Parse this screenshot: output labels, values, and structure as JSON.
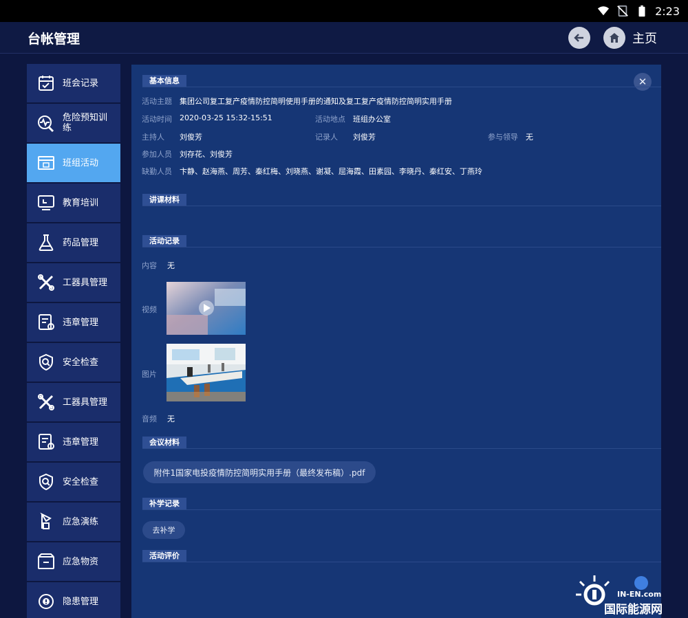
{
  "status_bar": {
    "time": "2:23"
  },
  "header": {
    "title": "台帐管理",
    "home_label": "主页"
  },
  "sidebar": {
    "items": [
      {
        "label": "班会记录",
        "icon": "calendar-icon"
      },
      {
        "label": "危险预知训练",
        "icon": "pulse-icon"
      },
      {
        "label": "班组活动",
        "icon": "window-icon",
        "active": true
      },
      {
        "label": "教育培训",
        "icon": "monitor-icon"
      },
      {
        "label": "药品管理",
        "icon": "flask-icon"
      },
      {
        "label": "工器具管理",
        "icon": "tools-icon"
      },
      {
        "label": "违章管理",
        "icon": "violation-doc-icon"
      },
      {
        "label": "安全检查",
        "icon": "shield-search-icon"
      },
      {
        "label": "工器具管理",
        "icon": "tools-icon"
      },
      {
        "label": "违章管理",
        "icon": "violation-doc-icon"
      },
      {
        "label": "安全检查",
        "icon": "shield-search-icon"
      },
      {
        "label": "应急演练",
        "icon": "drill-icon"
      },
      {
        "label": "应急物资",
        "icon": "box-icon"
      },
      {
        "label": "隐患管理",
        "icon": "hazard-icon"
      }
    ]
  },
  "basic_info": {
    "section_title": "基本信息",
    "topic_label": "活动主题",
    "topic_value": "集团公司复工复产疫情防控简明使用手册的通知及复工复产疫情防控简明实用手册",
    "time_label": "活动时间",
    "time_value": "2020-03-25 15:32-15:51",
    "place_label": "活动地点",
    "place_value": "班组办公室",
    "host_label": "主持人",
    "host_value": "刘俊芳",
    "recorder_label": "记录人",
    "recorder_value": "刘俊芳",
    "leader_label": "参与领导",
    "leader_value": "无",
    "participants_label": "参加人员",
    "participants_value": "刘存花、刘俊芳",
    "absent_label": "缺勤人员",
    "absent_value": "卞静、赵海燕、周芳、秦红梅、刘晓燕、谢凝、屈海霞、田素园、李晓丹、秦红安、丁燕玲"
  },
  "lecture": {
    "section_title": "讲课材料"
  },
  "activity_record": {
    "section_title": "活动记录",
    "content_label": "内容",
    "content_value": "无",
    "video_label": "视频",
    "image_label": "图片",
    "audio_label": "音频",
    "audio_value": "无"
  },
  "meeting": {
    "section_title": "会议材料",
    "attachment": "附件1国家电投疫情防控简明实用手册（最终发布稿）.pdf"
  },
  "makeup": {
    "section_title": "补学记录",
    "button_label": "去补学"
  },
  "evaluation": {
    "section_title": "活动评价"
  },
  "watermark": {
    "top_text": "IN-EN.com",
    "main_text": "国际能源网"
  },
  "colors": {
    "background": "#0d1740",
    "panel": "#163675",
    "sidebar_item": "#1a2d6b",
    "sidebar_active": "#53a7f0"
  }
}
